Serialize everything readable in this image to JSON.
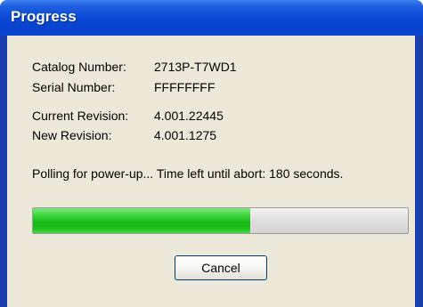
{
  "window": {
    "title": "Progress"
  },
  "info": {
    "catalog_label": "Catalog Number:",
    "catalog_value": "2713P-T7WD1",
    "serial_label": "Serial Number:",
    "serial_value": "FFFFFFFF",
    "current_revision_label": "Current Revision:",
    "current_revision_value": "4.001.22445",
    "new_revision_label": "New Revision:",
    "new_revision_value": "4.001.1275"
  },
  "status": {
    "message": "Polling for power-up... Time left until abort: 180 seconds."
  },
  "progress": {
    "fraction": 0.58,
    "fill_color": "#22c422"
  },
  "buttons": {
    "cancel_label": "Cancel"
  }
}
